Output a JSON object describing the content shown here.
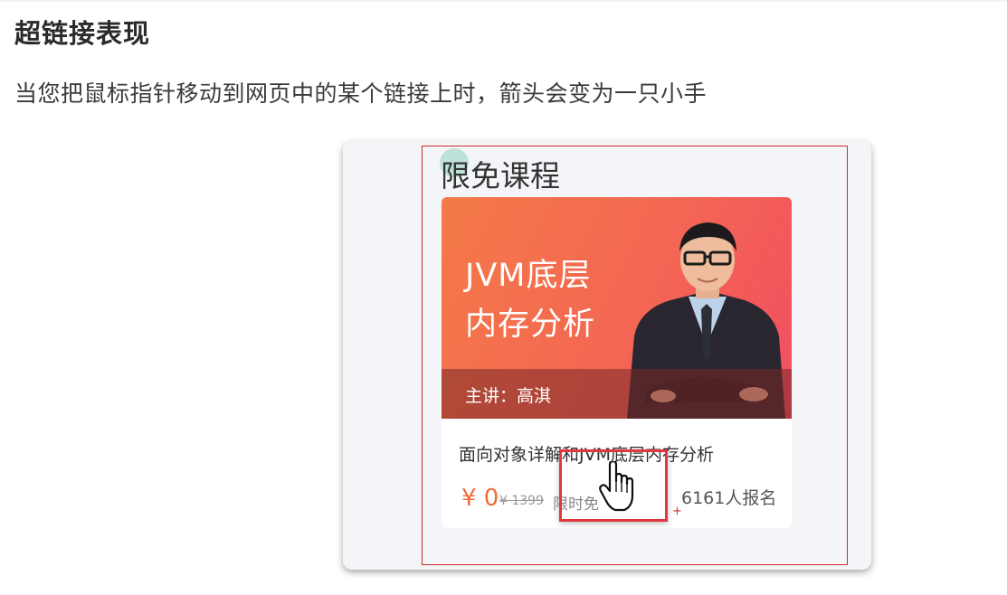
{
  "heading": "超链接表现",
  "paragraph": "当您把鼠标指针移动到网页中的某个链接上时，箭头会变为一只小手",
  "screenshot": {
    "section_title": "限免课程",
    "card": {
      "banner_line1": "JVM底层",
      "banner_line2": "内存分析",
      "lecturer": "主讲：高淇",
      "course_name": "面向对象详解和JVM底层内存分析",
      "price": "¥ 0",
      "original_price": "¥ 1399",
      "free_tag": "限时免",
      "signups": "6161人报名"
    },
    "cursor_icon": "hand-pointer-icon",
    "colors": {
      "highlight": "#d02a2a",
      "price": "#f26a3a",
      "banner_start": "#f47a48",
      "banner_end": "#f24e62"
    }
  }
}
